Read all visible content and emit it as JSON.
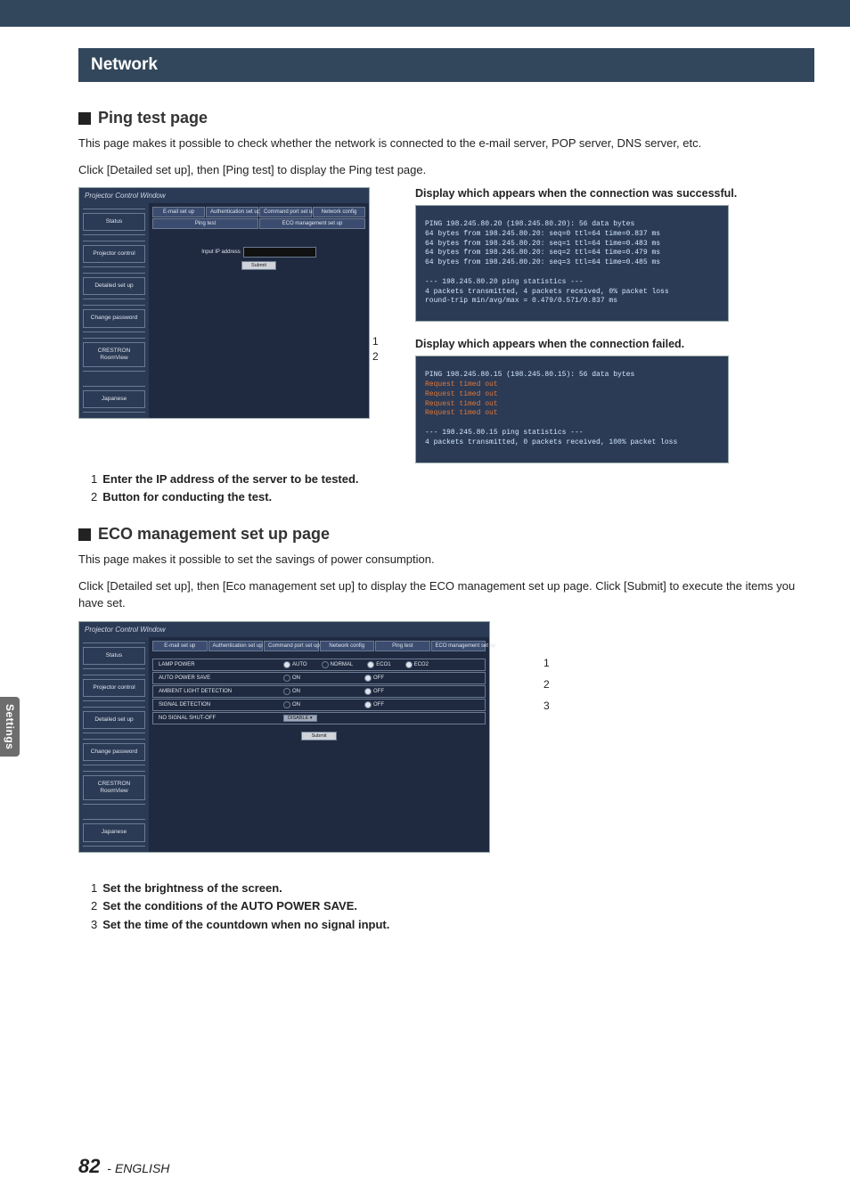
{
  "header": {
    "title": "Network"
  },
  "sideTab": "Settings",
  "ping": {
    "heading": "Ping test page",
    "desc1": "This page makes it possible to check whether the network is connected to the e-mail server, POP server, DNS server, etc.",
    "desc2": "Click [Detailed set up], then [Ping test] to display the Ping test page.",
    "callouts": {
      "c1": "1",
      "c2": "2",
      "t1": "Enter the IP address of the server to be tested.",
      "t2": "Button for conducting the test."
    },
    "display_ok": "Display which appears when the connection was successful.",
    "display_fail": "Display which appears when the connection failed.",
    "term_ok_l1": "PING 198.245.80.20 (198.245.80.20): 56 data bytes",
    "term_ok_l2": "64 bytes from 198.245.80.20: seq=0 ttl=64 time=0.837 ms",
    "term_ok_l3": "64 bytes from 198.245.80.20: seq=1 ttl=64 time=0.483 ms",
    "term_ok_l4": "64 bytes from 198.245.80.20: seq=2 ttl=64 time=0.479 ms",
    "term_ok_l5": "64 bytes from 198.245.80.20: seq=3 ttl=64 time=0.485 ms",
    "term_ok_l6": "--- 198.245.80.20 ping statistics ---",
    "term_ok_l7": "4 packets transmitted, 4 packets received, 0% packet loss",
    "term_ok_l8": "round-trip min/avg/max = 0.479/0.571/0.837 ms",
    "term_fail_l1": "PING 198.245.80.15 (198.245.80.15): 56 data bytes",
    "term_fail_l2": "Request timed out",
    "term_fail_l3": "Request timed out",
    "term_fail_l4": "Request timed out",
    "term_fail_l5": "Request timed out",
    "term_fail_l6": "--- 198.245.80.15 ping statistics ---",
    "term_fail_l7": "4 packets transmitted, 0 packets received, 100% packet loss"
  },
  "eco": {
    "heading": "ECO management set up page",
    "desc1": "This page makes it possible to set the savings of power consumption.",
    "desc2": "Click [Detailed set up], then [Eco management set up] to display the ECO management set up page. Click [Submit] to execute the items you have set.",
    "rows": {
      "lamp": "LAMP POWER",
      "auto": "AUTO POWER SAVE",
      "ambient": "AMBIENT LIGHT DETECTION",
      "signal": "SIGNAL DETECTION",
      "noSignal": "NO SIGNAL SHUT-OFF"
    },
    "opts": {
      "autoOpt": "AUTO",
      "normal": "NORMAL",
      "eco1": "ECO1",
      "eco2": "ECO2",
      "on": "ON",
      "off": "OFF",
      "disable": "DISABLE"
    },
    "callouts": {
      "c1": "1",
      "c2": "2",
      "c3": "3",
      "t1": "Set the brightness of the screen.",
      "t2": "Set the conditions of the AUTO POWER SAVE.",
      "t3": "Set the time of the countdown when no signal input."
    }
  },
  "pcw": {
    "title": "Projector Control Window",
    "side": {
      "status": "Status",
      "projector": "Projector control",
      "detailed": "Detailed set up",
      "change": "Change password",
      "crestron": "CRESTRON RoomView",
      "japanese": "Japanese"
    },
    "tabs": {
      "email": "E-mail set up",
      "auth": "Authentication set up",
      "command": "Command port set up",
      "network": "Network config",
      "ping": "Ping test",
      "eco": "ECO management set up"
    },
    "inputIp": "Input IP address",
    "submit": "Submit"
  },
  "footer": {
    "page": "82",
    "sep": " - ",
    "lang": "ENGLISH"
  }
}
